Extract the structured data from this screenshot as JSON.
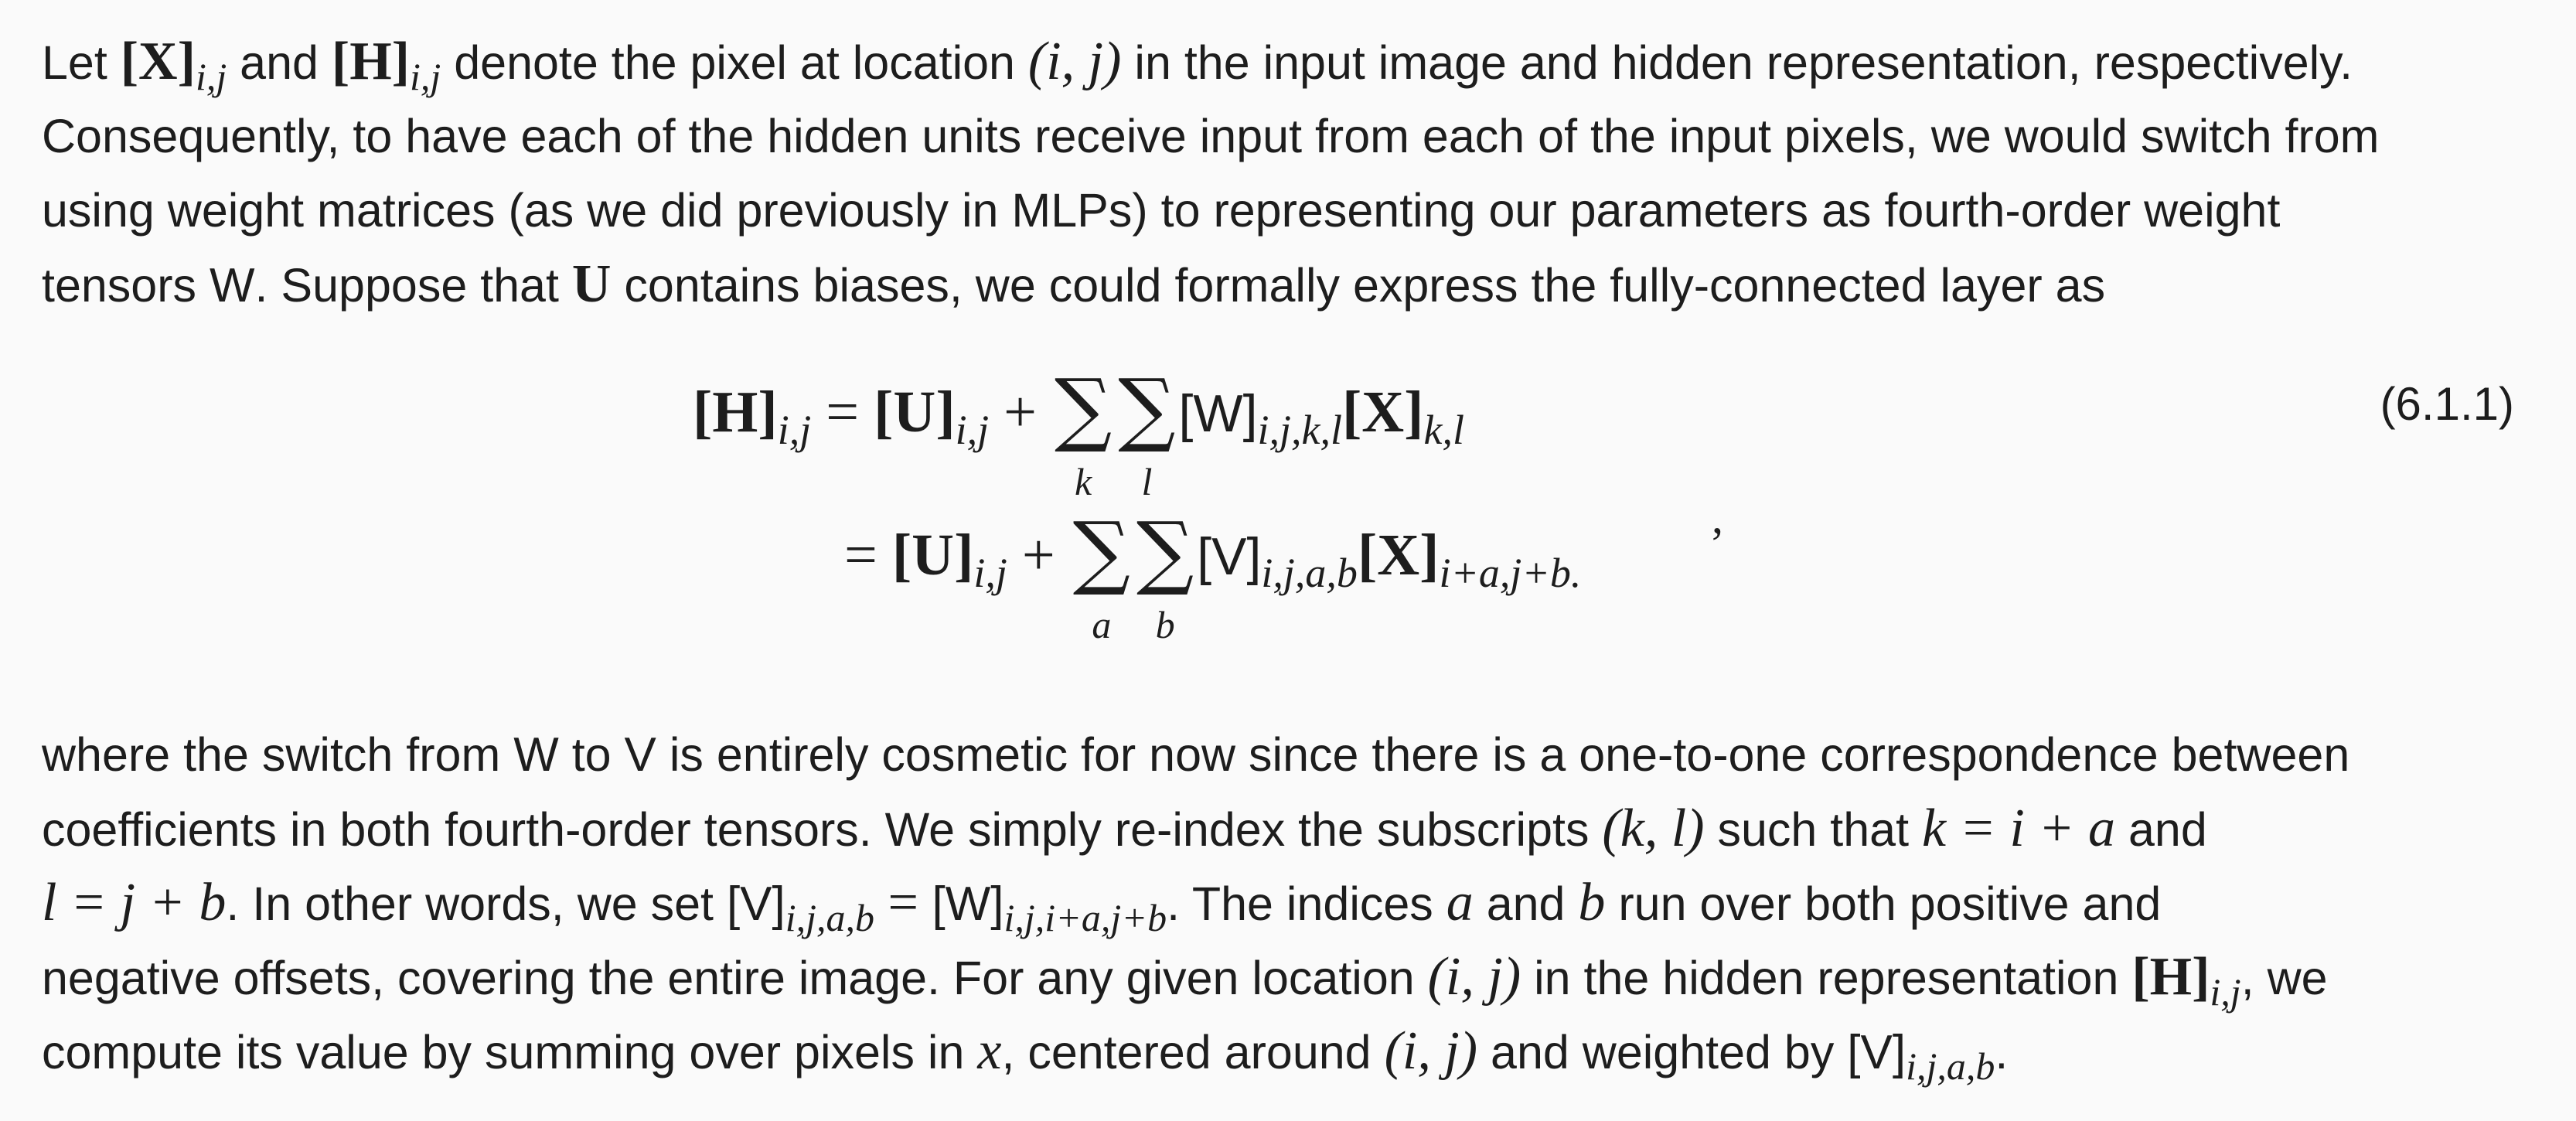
{
  "para1": {
    "l1": {
      "a": "Let ",
      "x": "[X]",
      "x_sub": "i,j",
      "b": " and ",
      "h": "[H]",
      "h_sub": "i,j",
      "c": " denote the pixel at location ",
      "loc": "(i, j)",
      "d": " in the input image and hidden representation, respectively."
    },
    "l2": "Consequently, to have each of the hidden units receive input from each of the input pixels, we would switch from",
    "l3": "using weight matrices (as we did previously in MLPs) to representing our parameters as fourth-order weight",
    "l4": {
      "a": "tensors ",
      "w": "W",
      "b": ". Suppose that ",
      "u": "U",
      "c": " contains biases, we could formally express the fully-connected layer as"
    }
  },
  "equation": {
    "number": "(6.1.1)",
    "row1": {
      "lhs": "[H]",
      "lhs_sub": "i,j",
      "eq": " = ",
      "u": "[U]",
      "u_sub": "i,j",
      "plus": " + ",
      "sigma": "∑",
      "lim1": "k",
      "lim2": "l",
      "w": "[W]",
      "w_sub": "i,j,k,l",
      "x": "[X]",
      "x_sub": "k,l"
    },
    "row2": {
      "eq": "= ",
      "u": "[U]",
      "u_sub": "i,j",
      "plus": " + ",
      "sigma": "∑",
      "lim1": "a",
      "lim2": "b",
      "v": "[V]",
      "v_sub": "i,j,a,b",
      "x": "[X]",
      "x_sub": "i+a,j+b",
      "end": ".",
      "comma": ","
    }
  },
  "para2": {
    "l1": {
      "a": "where the switch from ",
      "w": "W",
      "b": " to ",
      "v": "V",
      "c": " is entirely cosmetic for now since there is a one-to-one correspondence between"
    },
    "l2": {
      "a": "coefficients in both fourth-order tensors. We simply re-index the subscripts ",
      "kl": "(k, l)",
      "b": " such that ",
      "k": "k = i + a",
      "c": " and"
    },
    "l3": {
      "l": "l = j + b",
      "a": ". In other words, we set ",
      "v": "[V]",
      "v_sub": "i,j,a,b",
      "eq": " = ",
      "w": "[W]",
      "w_sub": "i,j,i+a,j+b",
      "b": ". The indices ",
      "ia": "a",
      "c": " and ",
      "ib": "b",
      "d": " run over both positive and"
    },
    "l4": {
      "a": "negative offsets, covering the entire image. For any given location ",
      "loc": "(i, j)",
      "b": " in the hidden representation ",
      "h": "[H]",
      "h_sub": "i,j",
      "c": ", we"
    },
    "l5": {
      "a": "compute its value by summing over pixels in ",
      "x": "x",
      "b": ", centered around ",
      "loc": "(i, j)",
      "c": " and weighted by ",
      "v": "[V]",
      "v_sub": "i,j,a,b",
      "d": "."
    }
  }
}
